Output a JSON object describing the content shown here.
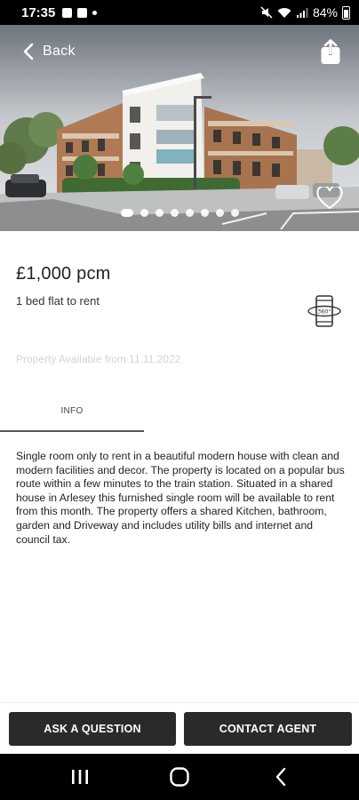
{
  "status_bar": {
    "time": "17:35",
    "battery": "84%",
    "left_icons": [
      "image-icon",
      "notification-icon",
      "dot-icon"
    ],
    "right_icons": [
      "mute-icon",
      "wifi-icon",
      "signal-icon",
      "battery-icon"
    ]
  },
  "header": {
    "back_label": "Back",
    "share_icon": "share-icon",
    "favourite_icon": "heart-icon"
  },
  "gallery": {
    "image_count": 8,
    "active_index": 0
  },
  "listing": {
    "price": "£1,000 pcm",
    "subtitle": "1 bed flat to rent",
    "tour_icon": "360-phone-icon",
    "availability": "Property Available from 11.11.2022"
  },
  "tabs": [
    {
      "label": "INFO",
      "active": true
    }
  ],
  "description": "Single room only to rent in a beautiful modern house with clean and modern facilities and decor. The property is located on a popular bus route within a few minutes to the train station. Situated in a shared house in Arlesey this furnished single room will be available to rent from this month. The property offers a shared Kitchen, bathroom, garden and Driveway and includes utility bills and internet and council tax.",
  "actions": {
    "ask_label": "ASK A QUESTION",
    "contact_label": "CONTACT AGENT"
  },
  "nav": {
    "recents_icon": "recents-icon",
    "home_icon": "home-icon",
    "back_icon": "back-icon"
  },
  "colors": {
    "button_bg": "#2a2a2a",
    "text_primary": "#222222",
    "text_muted": "#d4d4d4",
    "system_bar": "#000000"
  }
}
